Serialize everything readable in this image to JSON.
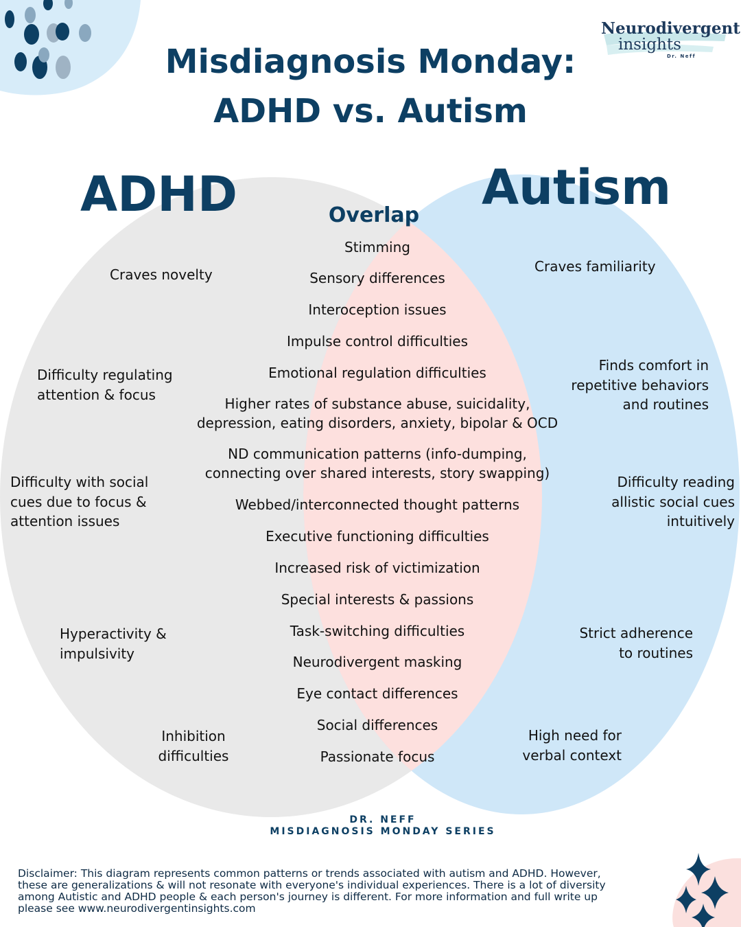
{
  "header": {
    "title_line1": "Misdiagnosis Monday:",
    "title_line2": "ADHD vs. Autism"
  },
  "logo": {
    "brand_line1": "Neurodivergent",
    "brand_line2": "insights",
    "byline": "Dr. Neff"
  },
  "diagram": {
    "left_label": "ADHD",
    "right_label": "Autism",
    "overlap_label": "Overlap",
    "colors": {
      "adhd_circle": "#e9e9e9",
      "autism_circle": "#cfe7f8",
      "overlap": "#fde0de",
      "heading": "#0d3f63"
    },
    "adhd_items": [
      "Craves novelty",
      "Difficulty regulating attention & focus",
      "Difficulty with social cues due to focus & attention issues",
      "Hyperactivity & impulsivity",
      "Inhibition difficulties"
    ],
    "autism_items": [
      "Craves familiarity",
      "Finds comfort in repetitive behaviors and routines",
      "Difficulty reading allistic social cues intuitively",
      "Strict adherence to routines",
      "High need for verbal context"
    ],
    "overlap_items": [
      "Stimming",
      "Sensory differences",
      "Interoception issues",
      "Impulse control difficulties",
      "Emotional regulation difficulties",
      "Higher rates of substance abuse, suicidality, depression, eating disorders, anxiety, bipolar & OCD",
      "ND communication patterns (info-dumping, connecting over shared interests, story swapping)",
      "Webbed/interconnected thought patterns",
      "Executive functioning difficulties",
      "Increased risk of victimization",
      "Special interests & passions",
      "Task-switching difficulties",
      "Neurodivergent masking",
      "Eye contact differences",
      "Social differences",
      "Passionate focus"
    ]
  },
  "footer": {
    "author": "DR. NEFF",
    "series": "MISDIAGNOSIS MONDAY SERIES",
    "disclaimer": "Disclaimer: This diagram represents common patterns or trends associated with autism and ADHD. However, these are generalizations & will not resonate with everyone's individual experiences. There is a lot of diversity among Autistic and ADHD people & each person's journey is different. For more information and full write up please see www.neurodivergentinsights.com"
  }
}
